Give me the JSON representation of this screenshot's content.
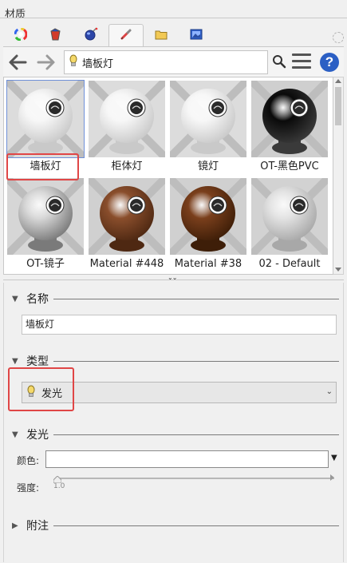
{
  "panel": {
    "title": "材质"
  },
  "tabs": [
    {
      "name": "color-wheel-icon"
    },
    {
      "name": "paint-bucket-icon"
    },
    {
      "name": "globe-icon"
    },
    {
      "name": "eyedropper-icon"
    },
    {
      "name": "folder-icon"
    },
    {
      "name": "picture-icon"
    }
  ],
  "nav": {
    "current": "墙板灯",
    "back_icon": "arrow-left-icon",
    "forward_icon": "arrow-right-icon",
    "search_icon": "search-icon",
    "menu_icon": "hamburger-menu-icon",
    "help_label": "?"
  },
  "materials": [
    {
      "label": "墙板灯",
      "selected": true,
      "style": "white"
    },
    {
      "label": "柜体灯",
      "selected": false,
      "style": "white"
    },
    {
      "label": "镜灯",
      "selected": false,
      "style": "white"
    },
    {
      "label": "OT-黑色PVC",
      "selected": false,
      "style": "black"
    },
    {
      "label": "OT-镜子",
      "selected": false,
      "style": "chrome"
    },
    {
      "label": "Material #448",
      "selected": false,
      "style": "wood"
    },
    {
      "label": "Material #38",
      "selected": false,
      "style": "wood-dark"
    },
    {
      "label": "02 - Default",
      "selected": false,
      "style": "grey"
    }
  ],
  "sections": {
    "name": {
      "label": "名称",
      "value": "墙板灯"
    },
    "type": {
      "label": "类型",
      "value": "发光"
    },
    "emission": {
      "label": "发光",
      "color_label": "颜色:",
      "color_value": "",
      "intensity_label": "强度:",
      "intensity_value": "1.0"
    },
    "notes": {
      "label": "附注"
    }
  },
  "colors": {
    "highlight": "#e04646",
    "help_blue": "#2b5fc4",
    "selection": "#6e8fd8"
  }
}
